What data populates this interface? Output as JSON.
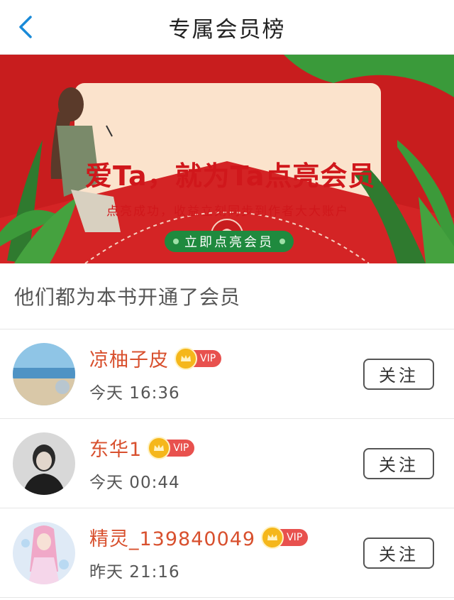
{
  "header": {
    "title": "专属会员榜",
    "back_icon": "chevron-left-icon"
  },
  "banner": {
    "title": "爱Ta，就为Ta点亮会员",
    "subtitle": "点亮成功，收益立刻同步到作者大大账户",
    "button": "立即点亮会员"
  },
  "section": {
    "title": "他们都为本书开通了会员"
  },
  "members": [
    {
      "name": "凉柚子皮",
      "badge": "VIP",
      "time": "今天 16:36",
      "follow": "关注"
    },
    {
      "name": "东华1",
      "badge": "VIP",
      "time": "今天 00:44",
      "follow": "关注"
    },
    {
      "name": "精灵_139840049",
      "badge": "VIP",
      "time": "昨天 21:16",
      "follow": "关注"
    }
  ],
  "colors": {
    "accent": "#d8502e",
    "banner_red": "#c81d1e",
    "vip": "#e8514e",
    "button_green": "#1f8a3e"
  }
}
